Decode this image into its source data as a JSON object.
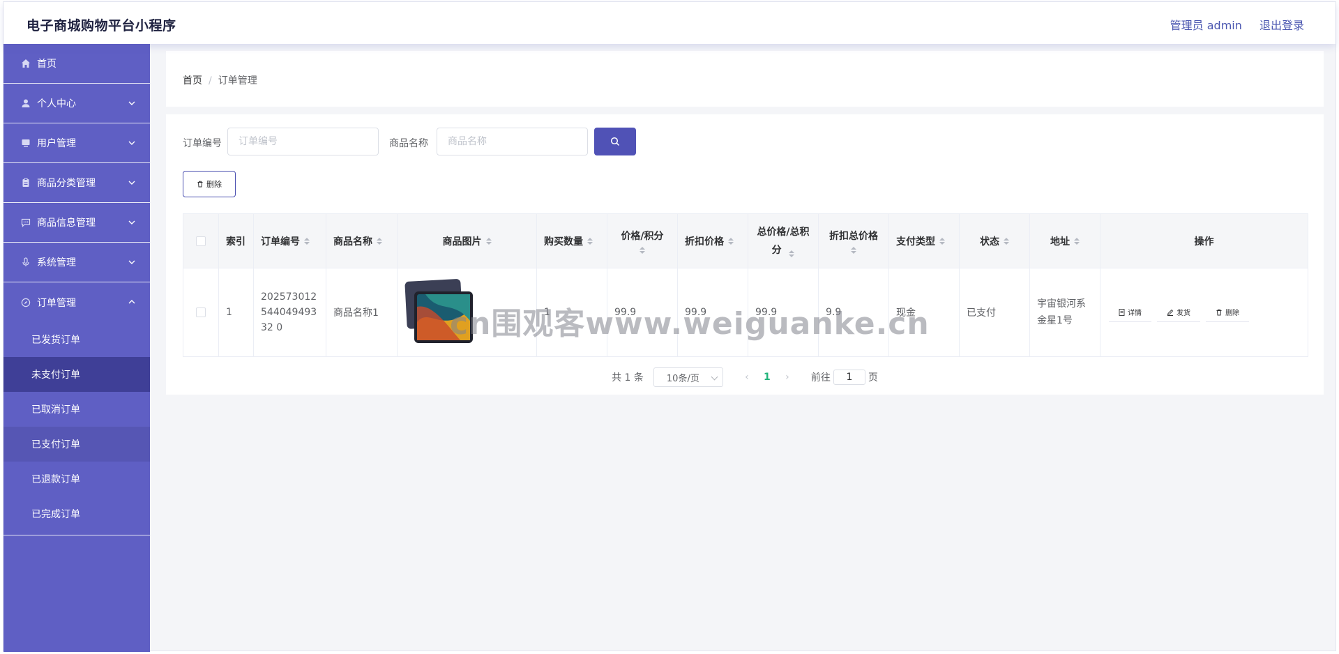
{
  "header": {
    "title": "电子商城购物平台小程序",
    "admin": "管理员 admin",
    "logout": "退出登录"
  },
  "sidebar": {
    "items": [
      {
        "label": "首页",
        "icon": "home-icon"
      },
      {
        "label": "个人中心",
        "icon": "user-icon"
      },
      {
        "label": "用户管理",
        "icon": "monitor-icon"
      },
      {
        "label": "商品分类管理",
        "icon": "clipboard-icon"
      },
      {
        "label": "商品信息管理",
        "icon": "chat-icon"
      },
      {
        "label": "系统管理",
        "icon": "microphone-icon"
      },
      {
        "label": "订单管理",
        "icon": "compass-icon"
      }
    ],
    "subitems": [
      "已发货订单",
      "未支付订单",
      "已取消订单",
      "已支付订单",
      "已退款订单",
      "已完成订单"
    ]
  },
  "breadcrumb": {
    "home": "首页",
    "sep": "/",
    "current": "订单管理"
  },
  "search": {
    "order_label": "订单编号",
    "order_placeholder": "订单编号",
    "name_label": "商品名称",
    "name_placeholder": "商品名称"
  },
  "toolbar": {
    "delete_label": "删除"
  },
  "table": {
    "headers": {
      "index": "索引",
      "order_no": "订单编号",
      "goods_name": "商品名称",
      "goods_image": "商品图片",
      "quantity": "购买数量",
      "price": "价格/积分",
      "discount_price": "折扣价格",
      "total": "总价格/总积分",
      "discount_total": "折扣总价格",
      "pay_type": "支付类型",
      "status": "状态",
      "address": "地址",
      "actions": "操作"
    },
    "rows": [
      {
        "index": "1",
        "order_no": "20257301254404949332 0",
        "goods_name": "商品名称1",
        "quantity": "1",
        "price": "99.9",
        "discount_price": "99.9",
        "total": "99.9",
        "discount_total": "9.9",
        "pay_type": "现金",
        "status": "已支付",
        "address": "宇宙银河系金星1号"
      }
    ],
    "actions": {
      "detail": "详情",
      "ship": "发货",
      "delete": "删除"
    }
  },
  "pagination": {
    "total": "共 1 条",
    "page_size": "10条/页",
    "current_page": "1",
    "goto_label": "前往",
    "goto_value": "1",
    "goto_suffix": "页"
  },
  "watermark": "cn围观客www.weiguanke.cn",
  "colors": {
    "sidebar": "#5f5fc4",
    "sidebar_active": "#3f3f97",
    "primary": "#5052b6",
    "page_active": "#21b37a"
  }
}
